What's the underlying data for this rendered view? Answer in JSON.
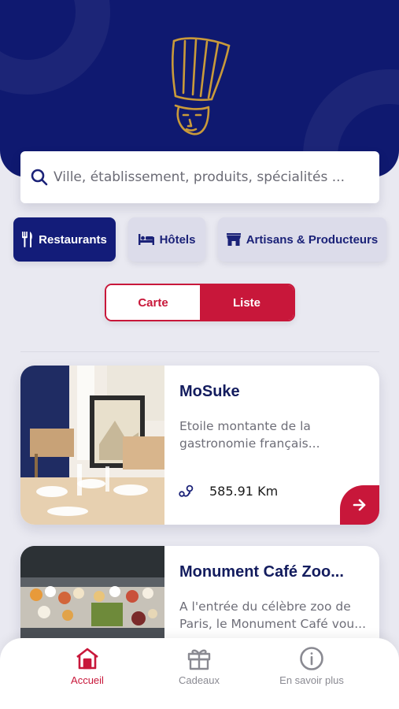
{
  "search": {
    "placeholder": "Ville, établissement, produits, spécialités ..."
  },
  "categories": [
    {
      "label": "Restaurants",
      "icon": "fork-knife-icon",
      "active": true
    },
    {
      "label": "Hôtels",
      "icon": "bed-icon",
      "active": false
    },
    {
      "label": "Artisans & Producteurs",
      "icon": "shop-icon",
      "active": false
    }
  ],
  "view_toggle": {
    "options": [
      "Carte",
      "Liste"
    ],
    "selected": "Liste"
  },
  "listings": [
    {
      "title": "MoSuke",
      "description": "Etoile montante de la gastronomie français...",
      "distance": "585.91 Km"
    },
    {
      "title": "Monument Café Zoo...",
      "description": "A l'entrée du célèbre zoo de Paris, le Monument Café vou...",
      "distance": ""
    }
  ],
  "tabbar": [
    {
      "label": "Accueil",
      "icon": "home-icon",
      "active": true
    },
    {
      "label": "Cadeaux",
      "icon": "gift-icon",
      "active": false
    },
    {
      "label": "En savoir plus",
      "icon": "info-icon",
      "active": false
    }
  ],
  "colors": {
    "navy": "#0f1970",
    "accent_red": "#c8173a",
    "background": "#e9e9f1",
    "logo_gold": "#c99a3a"
  }
}
